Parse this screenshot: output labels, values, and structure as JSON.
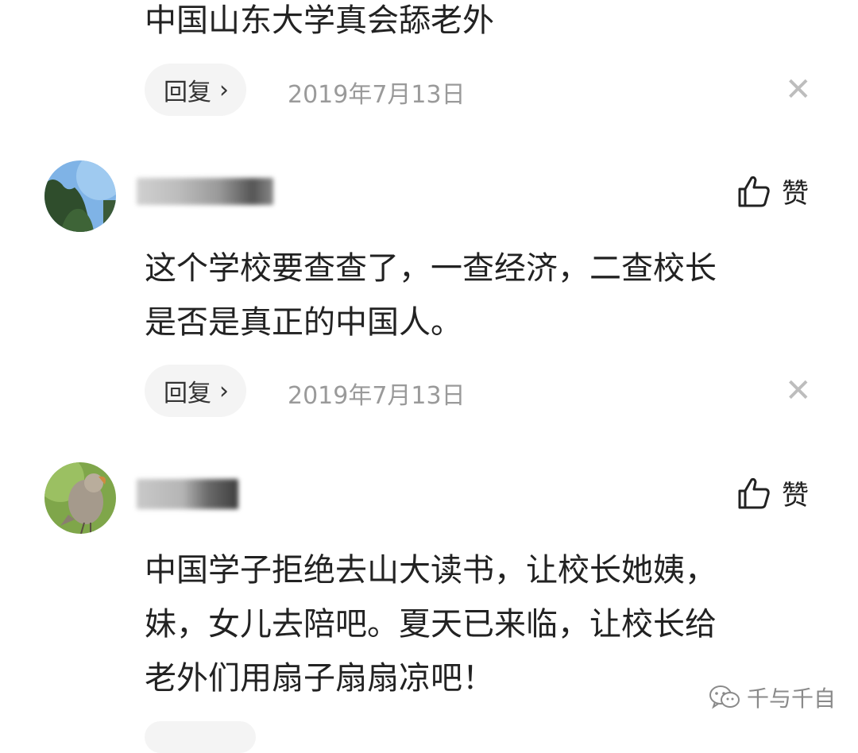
{
  "comments": [
    {
      "text_lines": [
        "中国山东大学真会舔老外"
      ],
      "reply_label": "回复",
      "date": "2019年7月13日"
    },
    {
      "text_lines": [
        "这个学校要查查了，一查经济，二查校长",
        "是否是真正的中国人。"
      ],
      "reply_label": "回复",
      "date": "2019年7月13日",
      "like_label": "赞"
    },
    {
      "text_lines": [
        "中国学子拒绝去山大读书，让校长她姨，",
        "妹，女儿去陪吧。夏天已来临，让校长给",
        "老外们用扇子扇扇凉吧！"
      ],
      "like_label": "赞"
    }
  ],
  "watermark": {
    "text": "千与千自"
  },
  "colors": {
    "date": "#9a9a9a",
    "pill_bg": "#f4f4f4",
    "close": "#bdbdbd"
  }
}
